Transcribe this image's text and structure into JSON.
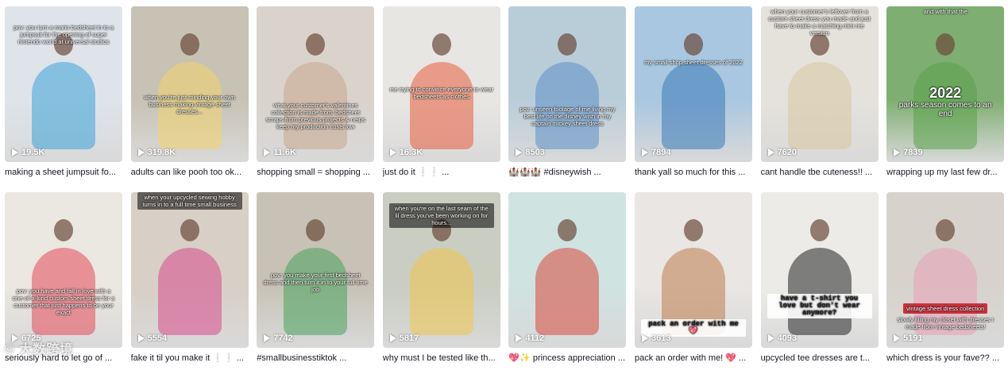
{
  "videos": [
    {
      "views": "19.5K",
      "caption": "making a sheet jumpsuit fo...",
      "overlay": "pov: you turn a mario bedsheet in to a jumpsuit for the opening of super nintendo world at universal studios",
      "bg": "#dfe4ea"
    },
    {
      "views": "319.8K",
      "caption": "adults can like pooh too ok...",
      "overlay": "when you're just minding your own business making vintage sheet dresses...",
      "bg": "#c8c2b4"
    },
    {
      "views": "11.6K",
      "caption": "shopping small = shopping ...",
      "overlay": "what your customer's valentines collection is made from: bedsheet scraps from previous projects & neips keep my production costs low",
      "bg": "#d9d3cc"
    },
    {
      "views": "16.3K",
      "caption": "just do it ❕❕ ...",
      "overlay": "me trying to convince everyone to wear bedsheets as clothes",
      "bg": "#e8e6e3"
    },
    {
      "views": "8503",
      "caption": "🏰🏰🏰 #disneywish ...",
      "overlay": "pov: unseen footage of me living my best life on the disney wish in my captain mickey sheet dress",
      "bg": "#b9cdd9"
    },
    {
      "views": "7894",
      "caption": "thank yall so much for this ...",
      "overlay": "my small shop sheet dresses of 2022",
      "bg": "#a9c7e0"
    },
    {
      "views": "7620",
      "caption": "cant handle tbe cuteness!! ...",
      "overlay": "when your customer's leftover from a custom sheet dress you made and just have to make a matching mini me version",
      "bg": "#e5e2dc"
    },
    {
      "views": "7839",
      "caption": "wrapping up my last few dr...",
      "overlay": "and with that the",
      "overlay2": "2022",
      "overlay3": "parks season comes to an end",
      "bg": "#7fae72"
    },
    {
      "views": "6725",
      "caption": "seriously hard to let go of ...",
      "overlay": "pov: you have and fall in love with a one-of-a-kind custom sheet dress for a customer that just happens to be your exact",
      "bg": "#ebe7e1"
    },
    {
      "views": "5554",
      "caption": "fake it til you make it ❕❕ ...",
      "overlay": "when your upcycled sewing hobby turns in to a full time small business",
      "bg": "#d8cfc6"
    },
    {
      "views": "7742",
      "caption": "#smallbusinesstiktok ...",
      "overlay": "pov: you make your first bedsheet dress and then turn it in to your full time job",
      "bg": "#c7c2b5"
    },
    {
      "views": "5817",
      "caption": "why must I be tested like th...",
      "overlay": "when you're on the last seam of the lil dress you've been working on for hours...",
      "bg": "#c9cdc2"
    },
    {
      "views": "4112",
      "caption": "💖✨ princess appreciation ...",
      "overlay": "",
      "bg": "#cfe3e1"
    },
    {
      "views": "3613",
      "caption": "pack an order with me! 💖 ...",
      "overlay": "pack an order with me 💖",
      "bg": "#e9e6e4"
    },
    {
      "views": "4093",
      "caption": "upcycled tee dresses are t...",
      "overlay": "have a t-shirt you love but don't wear anymore?",
      "bg": "#ecebe8"
    },
    {
      "views": "5191",
      "caption": "which dress is your fave?? ...",
      "overlay": "vintage sheet dress collection",
      "overlay2": "slowly filling my closet with dresses I made from vintage bedsheets!",
      "bg": "#d7d3cc"
    }
  ],
  "watermark": "© 大数跨境",
  "icons": {
    "play": "play-icon"
  }
}
